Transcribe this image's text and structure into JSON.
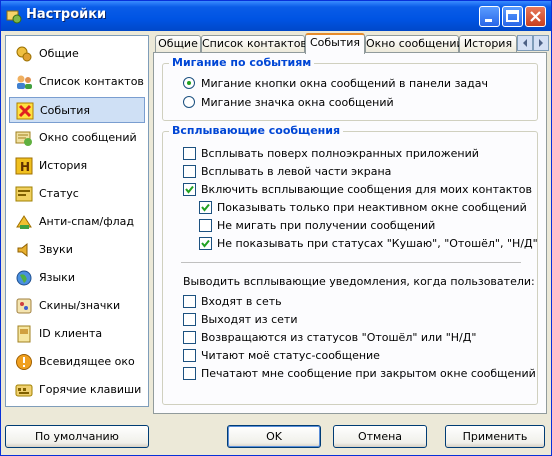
{
  "window": {
    "title": "Настройки"
  },
  "sidebar": {
    "items": [
      {
        "label": "Общие",
        "icon": "gears-icon"
      },
      {
        "label": "Список контактов",
        "icon": "contacts-icon"
      },
      {
        "label": "События",
        "icon": "events-icon",
        "selected": true
      },
      {
        "label": "Окно сообщений",
        "icon": "message-window-icon"
      },
      {
        "label": "История",
        "icon": "history-icon"
      },
      {
        "label": "Статус",
        "icon": "status-icon"
      },
      {
        "label": "Анти-спам/флад",
        "icon": "antispam-icon"
      },
      {
        "label": "Звуки",
        "icon": "sounds-icon"
      },
      {
        "label": "Языки",
        "icon": "languages-icon"
      },
      {
        "label": "Скины/значки",
        "icon": "skins-icon"
      },
      {
        "label": "ID клиента",
        "icon": "client-id-icon"
      },
      {
        "label": "Всевидящее око",
        "icon": "all-seeing-eye-icon"
      },
      {
        "label": "Горячие клавиши",
        "icon": "hotkeys-icon"
      }
    ]
  },
  "tabs": [
    {
      "label": "Общие"
    },
    {
      "label": "Список контактов"
    },
    {
      "label": "События",
      "active": true
    },
    {
      "label": "Окно сообщений"
    },
    {
      "label": "История"
    }
  ],
  "blink_group": {
    "title": "Мигание по событиям",
    "options": [
      {
        "label": "Мигание кнопки окна сообщений в панели задач",
        "selected": true
      },
      {
        "label": "Мигание значка окна сообщений",
        "selected": false
      }
    ]
  },
  "popup_group": {
    "title": "Всплывающие сообщения",
    "checks": [
      {
        "label": "Всплывать поверх полноэкранных приложений",
        "checked": false
      },
      {
        "label": "Всплывать в левой части экрана",
        "checked": false
      },
      {
        "label": "Включить всплывающие сообщения для моих контактов",
        "checked": true
      },
      {
        "label": "Показывать только при неактивном окне сообщений",
        "checked": true
      },
      {
        "label": "Не мигать при получении сообщений",
        "checked": false
      },
      {
        "label": "Не показывать при статусах \"Кушаю\", \"Отошёл\", \"Н/Д\"",
        "checked": true
      }
    ],
    "notify_label": "Выводить всплывающие уведомления, когда пользователи:",
    "notify_checks": [
      {
        "label": "Входят в сеть",
        "checked": false
      },
      {
        "label": "Выходят из сети",
        "checked": false
      },
      {
        "label": "Возвращаются из статусов \"Отошёл\" или \"Н/Д\"",
        "checked": false
      },
      {
        "label": "Читают моё статус-сообщение",
        "checked": false
      },
      {
        "label": "Печатают мне сообщение при закрытом окне сообщений",
        "checked": false
      }
    ]
  },
  "buttons": {
    "defaults": "По умолчанию",
    "ok": "OK",
    "cancel": "Отмена",
    "apply": "Применить"
  },
  "colors": {
    "titlebar": "#0054e3",
    "group_title": "#0046d5",
    "active_tab_accent": "#e68b2c",
    "check_mark": "#21a121"
  }
}
